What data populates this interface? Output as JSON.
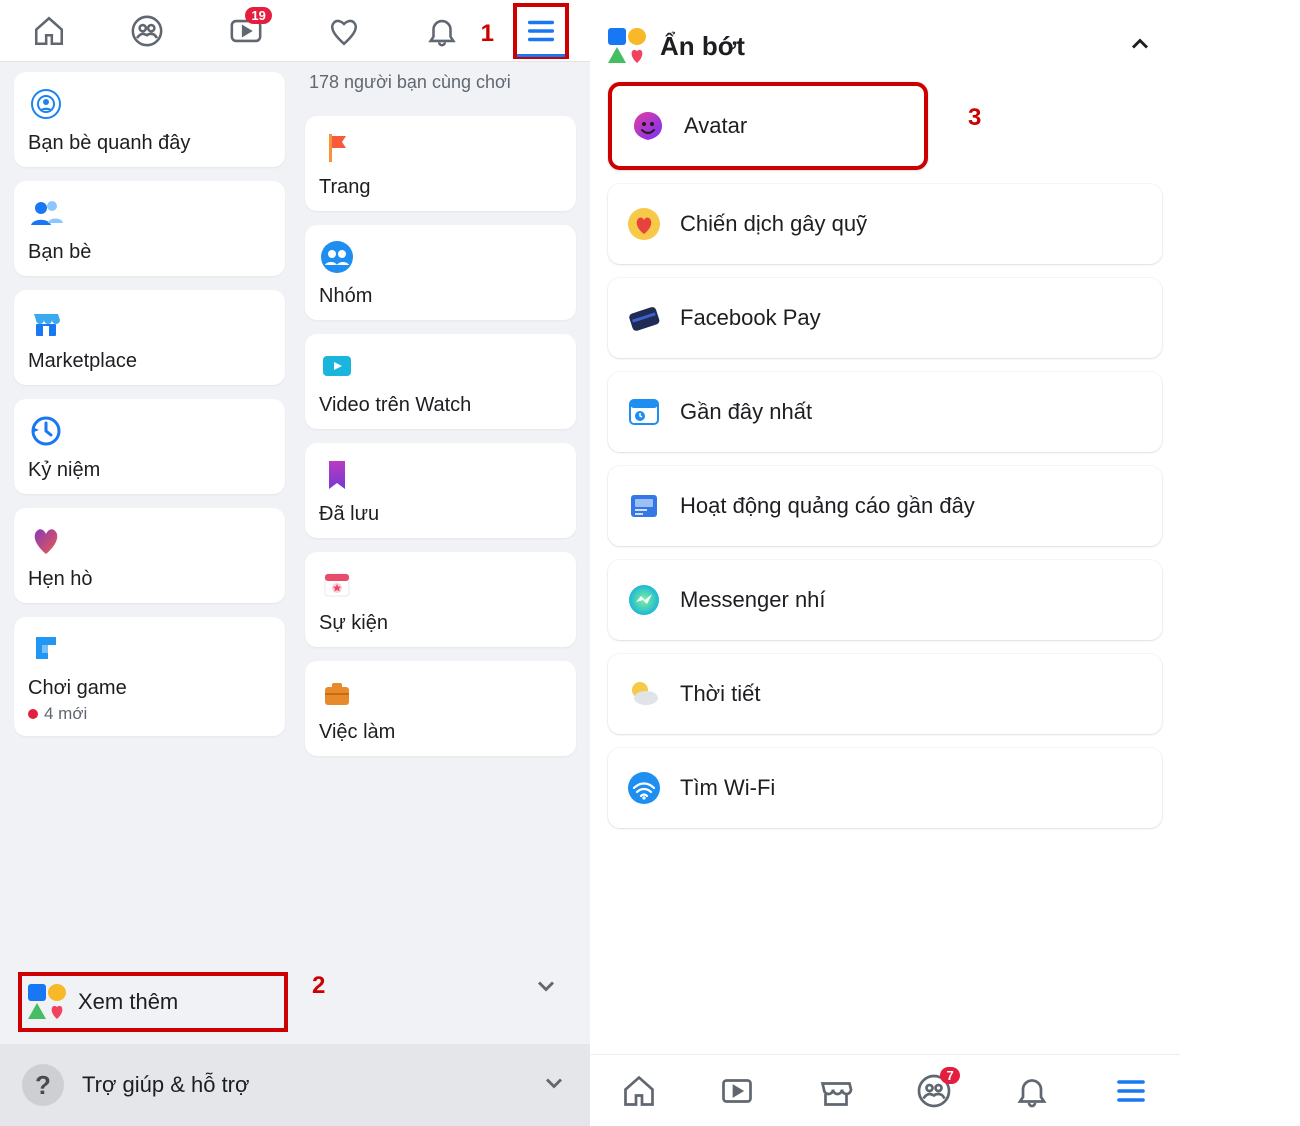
{
  "topnav": {
    "watch_badge": "19"
  },
  "annotations": {
    "one": "1",
    "two": "2",
    "three": "3"
  },
  "left": {
    "subline": "178 người bạn cùng chơi",
    "tiles_colA": [
      {
        "label": "Bạn bè quanh đây",
        "icon": "nearby"
      },
      {
        "label": "Bạn bè",
        "icon": "friends"
      },
      {
        "label": "Marketplace",
        "icon": "marketplace"
      },
      {
        "label": "Kỷ niệm",
        "icon": "memories"
      },
      {
        "label": "Hẹn hò",
        "icon": "dating"
      },
      {
        "label": "Chơi game",
        "icon": "gaming",
        "sub": "4 mới"
      }
    ],
    "tiles_colB": [
      {
        "label": "Trang",
        "icon": "flag"
      },
      {
        "label": "Nhóm",
        "icon": "groups"
      },
      {
        "label": "Video trên Watch",
        "icon": "watch"
      },
      {
        "label": "Đã lưu",
        "icon": "saved"
      },
      {
        "label": "Sự kiện",
        "icon": "events"
      },
      {
        "label": "Việc làm",
        "icon": "jobs"
      }
    ],
    "see_more": "Xem thêm",
    "help": "Trợ giúp & hỗ trợ"
  },
  "right": {
    "header": "Ẩn bớt",
    "items": [
      {
        "label": "Avatar",
        "icon": "avatar",
        "highlight": true
      },
      {
        "label": "Chiến dịch gây quỹ",
        "icon": "fundraiser"
      },
      {
        "label": "Facebook Pay",
        "icon": "pay"
      },
      {
        "label": "Gần đây nhất",
        "icon": "recent"
      },
      {
        "label": "Hoạt động quảng cáo gần đây",
        "icon": "ads"
      },
      {
        "label": "Messenger nhí",
        "icon": "messenger-kids"
      },
      {
        "label": "Thời tiết",
        "icon": "weather"
      },
      {
        "label": "Tìm Wi-Fi",
        "icon": "wifi"
      }
    ],
    "nav_badge": "7"
  }
}
